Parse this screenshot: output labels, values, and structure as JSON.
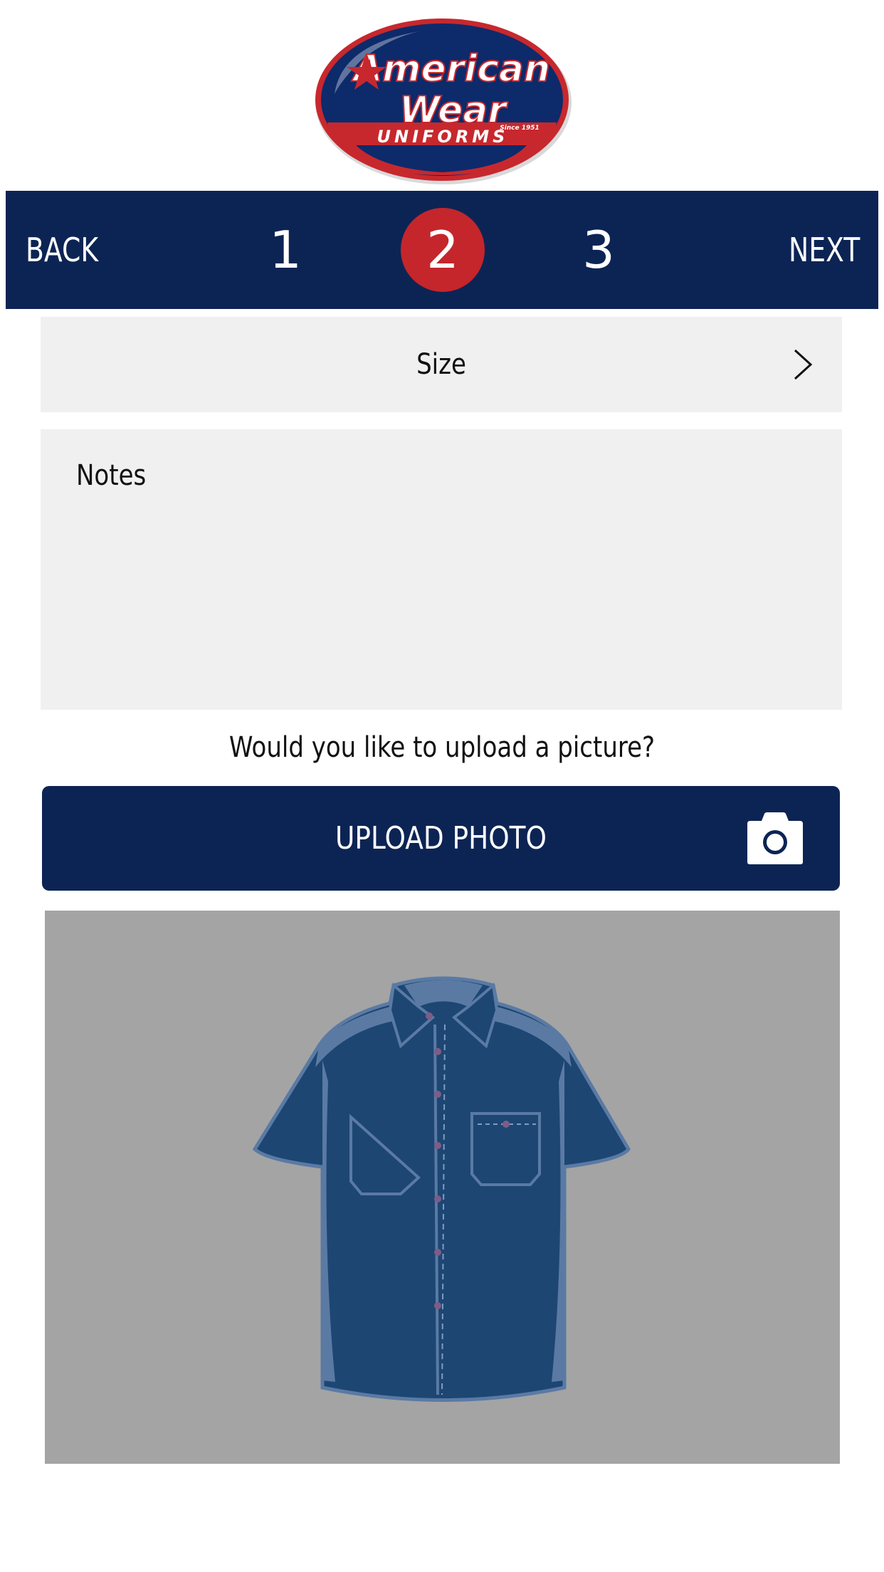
{
  "logo": {
    "line1": "American",
    "line2": "Wear",
    "since": "Since 1951",
    "band": "UNIFORMS"
  },
  "nav": {
    "back_label": "BACK",
    "next_label": "NEXT",
    "steps": [
      "1",
      "2",
      "3"
    ],
    "active_step": 2
  },
  "form": {
    "size_label": "Size",
    "notes_placeholder": "Notes",
    "question": "Would you like to upload a picture?",
    "upload_label": "UPLOAD PHOTO"
  },
  "colors": {
    "navy": "#0c2454",
    "red": "#c4262b",
    "field_bg": "#f0f0f0",
    "photo_bg": "#a4a4a4"
  }
}
